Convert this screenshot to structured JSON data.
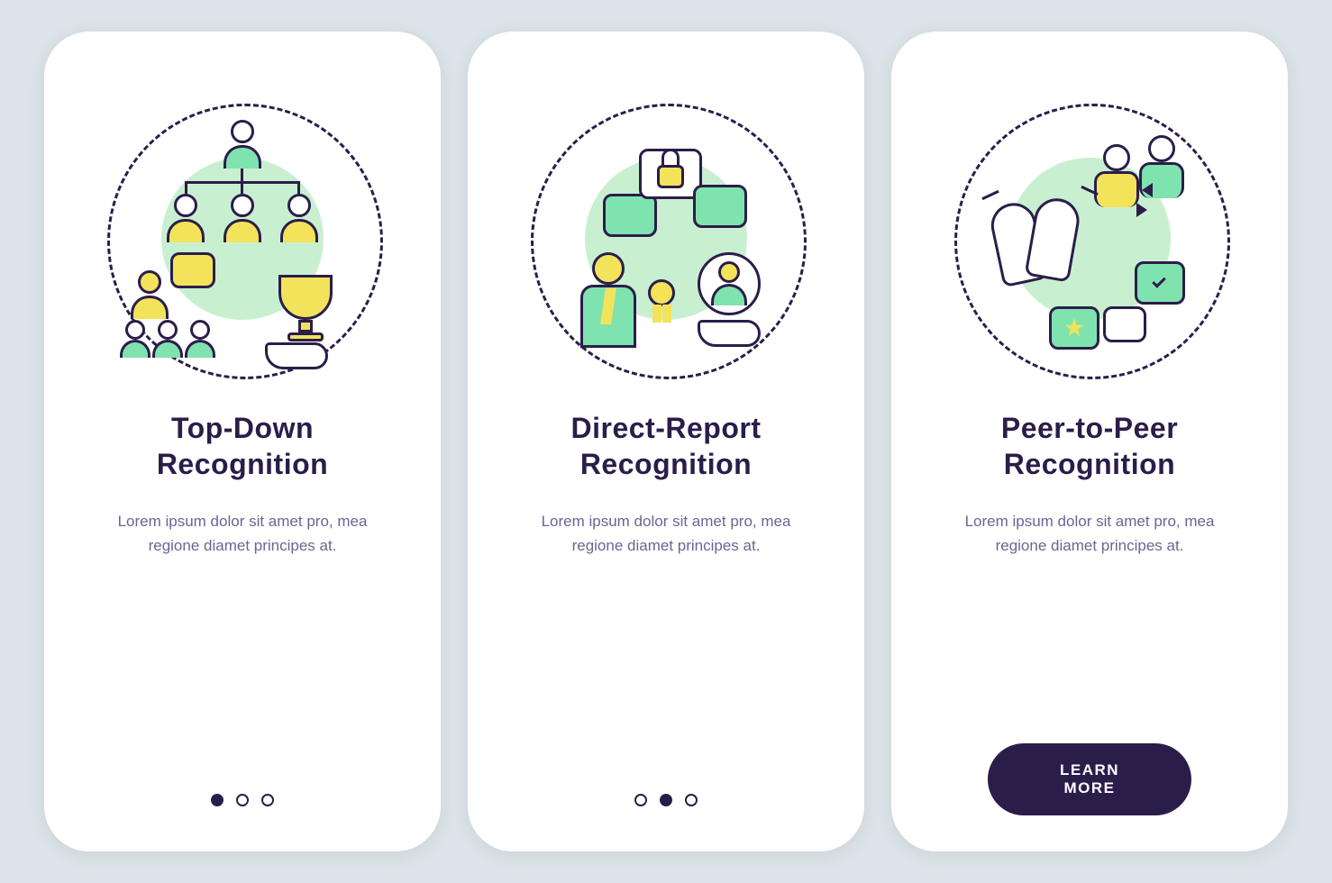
{
  "screens": [
    {
      "icon_name": "top-down-recognition-icon",
      "title_line1": "Top-Down",
      "title_line2": "Recognition",
      "body": "Lorem ipsum dolor sit amet pro, mea regione diamet principes at.",
      "pager_active_index": 0,
      "has_cta": false
    },
    {
      "icon_name": "direct-report-recognition-icon",
      "title_line1": "Direct-Report",
      "title_line2": "Recognition",
      "body": "Lorem ipsum dolor sit amet pro, mea regione diamet principes at.",
      "pager_active_index": 1,
      "has_cta": false
    },
    {
      "icon_name": "peer-to-peer-recognition-icon",
      "title_line1": "Peer-to-Peer",
      "title_line2": "Recognition",
      "body": "Lorem ipsum dolor sit amet pro, mea regione diamet principes at.",
      "pager_active_index": 2,
      "has_cta": true
    }
  ],
  "cta_label": "LEARN MORE",
  "colors": {
    "background": "#dbe4e8",
    "card": "#ffffff",
    "ink": "#2b1d4a",
    "accent_green": "#7fe3b0",
    "accent_yellow": "#f2e35a",
    "text_muted": "#6b6594"
  }
}
